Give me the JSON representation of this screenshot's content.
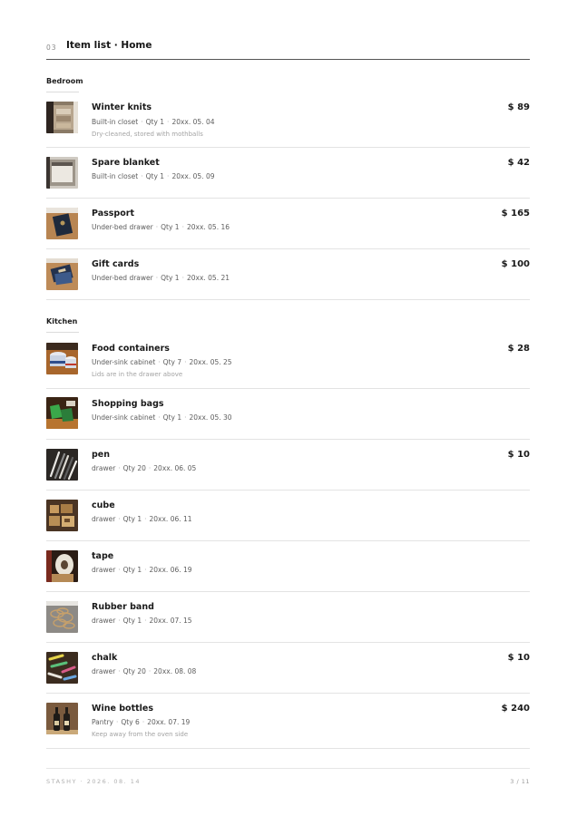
{
  "header": {
    "page_code": "03",
    "title": "Item list · Home"
  },
  "sections": [
    {
      "label": "Bedroom",
      "items": [
        {
          "name": "Winter knits",
          "location": "Built-in closet",
          "qty": "Qty 1",
          "date": "20xx. 05. 04",
          "note": "Dry-cleaned, stored with mothballs",
          "price": "$ 89",
          "photo": "closet-knits-photo"
        },
        {
          "name": "Spare blanket",
          "location": "Built-in closet",
          "qty": "Qty 1",
          "date": "20xx. 05. 09",
          "price": "$ 42",
          "photo": "closet-blanket-photo"
        },
        {
          "name": "Passport",
          "location": "Under-bed drawer",
          "qty": "Qty 1",
          "date": "20xx. 05. 16",
          "price": "$ 165",
          "photo": "passport-photo"
        },
        {
          "name": "Gift cards",
          "location": "Under-bed drawer",
          "qty": "Qty 1",
          "date": "20xx. 05. 21",
          "price": "$ 100",
          "photo": "gift-cards-photo"
        }
      ]
    },
    {
      "label": "Kitchen",
      "items": [
        {
          "name": "Food containers",
          "location": "Under-sink cabinet",
          "qty": "Qty 7",
          "date": "20xx. 05. 25",
          "note": "Lids are in the drawer above",
          "price": "$ 28",
          "photo": "containers-photo"
        },
        {
          "name": "Shopping bags",
          "location": "Under-sink cabinet",
          "qty": "Qty 1",
          "date": "20xx. 05. 30",
          "photo": "bags-photo"
        },
        {
          "name": "pen",
          "location": "drawer",
          "qty": "Qty 20",
          "date": "20xx. 06. 05",
          "price": "$ 10",
          "photo": "pens-photo"
        },
        {
          "name": "cube",
          "location": "drawer",
          "qty": "Qty 1",
          "date": "20xx. 06. 11",
          "photo": "cube-photo"
        },
        {
          "name": "tape",
          "location": "drawer",
          "qty": "Qty 1",
          "date": "20xx. 06. 19",
          "photo": "tape-photo"
        },
        {
          "name": "Rubber band",
          "location": "drawer",
          "qty": "Qty 1",
          "date": "20xx. 07. 15",
          "photo": "rubber-band-photo"
        },
        {
          "name": "chalk",
          "location": "drawer",
          "qty": "Qty 20",
          "date": "20xx. 08. 08",
          "price": "$ 10",
          "photo": "chalk-photo"
        },
        {
          "name": "Wine bottles",
          "location": "Pantry",
          "qty": "Qty 6",
          "date": "20xx. 07. 19",
          "note": "Keep away from the oven side",
          "price": "$ 240",
          "photo": "wine-photo"
        }
      ]
    }
  ],
  "footer": {
    "brand": "STASHY · 2026. 08. 14",
    "page": "3 / 11"
  }
}
